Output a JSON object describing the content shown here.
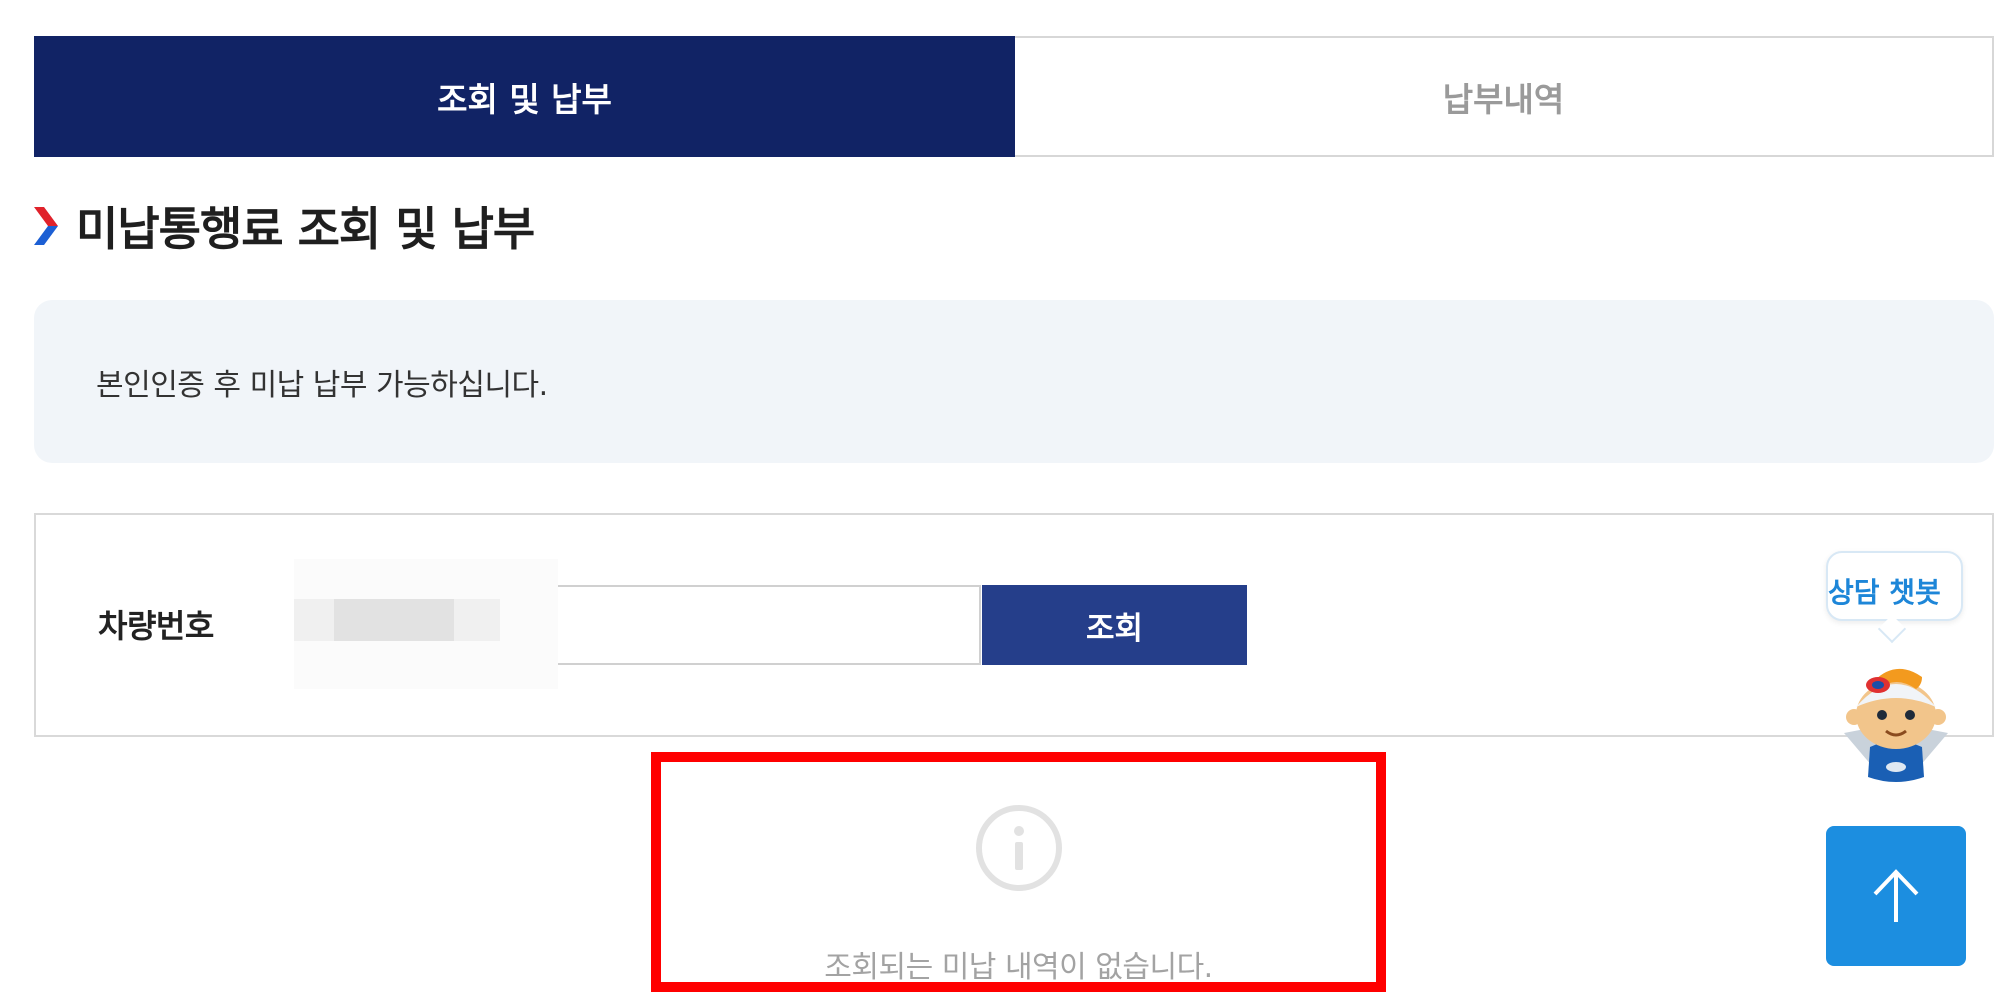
{
  "tabs": [
    {
      "label": "조회 및 납부",
      "active": true
    },
    {
      "label": "납부내역",
      "active": false
    }
  ],
  "section": {
    "title": "미납통행료 조회 및 납부"
  },
  "notice": {
    "text": "본인인증 후 미납 납부 가능하십니다."
  },
  "search": {
    "label": "차량번호",
    "input_value": "",
    "button_label": "조회"
  },
  "result": {
    "empty_message": "조회되는 미납 내역이 없습니다."
  },
  "chatbot": {
    "bubble_text": "상담 챗봇"
  },
  "colors": {
    "tab_active": "#112365",
    "search_button": "#253e8a",
    "notice_bg": "#f1f5f9",
    "highlight": "#ff0000",
    "top_button": "#1c8ee0",
    "chatbot_text": "#1d86d8"
  },
  "icons": [
    "chevron-right-icon",
    "info-icon",
    "arrow-up-icon",
    "chatbot-mascot-icon"
  ]
}
